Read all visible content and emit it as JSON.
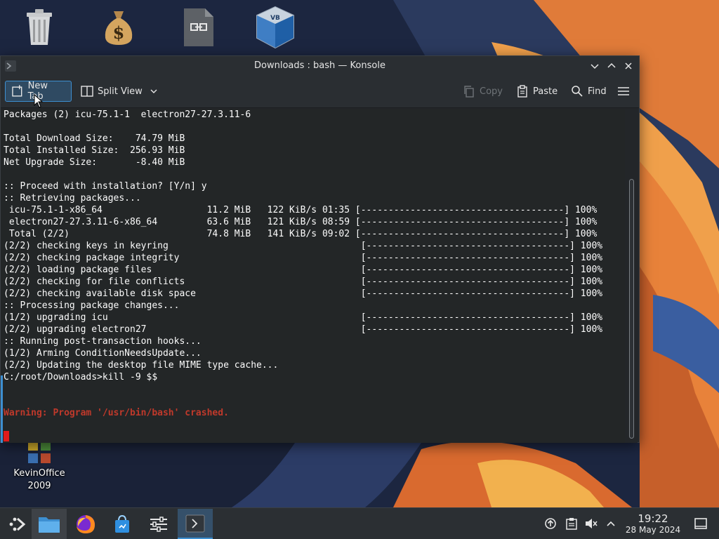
{
  "desktop": {
    "icons": [
      {
        "name": "trash"
      },
      {
        "name": "money-bag"
      },
      {
        "name": "file-link"
      },
      {
        "name": "virtualbox"
      },
      {
        "label_line1": "KevinOffice",
        "label_line2": "2009"
      }
    ]
  },
  "window": {
    "title": "Downloads : bash — Konsole",
    "toolbar": {
      "new_tab": "New Tab",
      "split_view": "Split View",
      "copy": "Copy",
      "paste": "Paste",
      "find": "Find"
    }
  },
  "terminal": {
    "lines": [
      "Packages (2) icu-75.1-1  electron27-27.3.11-6",
      "",
      "Total Download Size:    74.79 MiB",
      "Total Installed Size:  256.93 MiB",
      "Net Upgrade Size:       -8.40 MiB",
      "",
      ":: Proceed with installation? [Y/n] y",
      ":: Retrieving packages...",
      " icu-75.1-1-x86_64                   11.2 MiB   122 KiB/s 01:35 [-------------------------------------] 100%",
      " electron27-27.3.11-6-x86_64         63.6 MiB   121 KiB/s 08:59 [-------------------------------------] 100%",
      " Total (2/2)                         74.8 MiB   141 KiB/s 09:02 [-------------------------------------] 100%",
      "(2/2) checking keys in keyring                                   [-------------------------------------] 100%",
      "(2/2) checking package integrity                                 [-------------------------------------] 100%",
      "(2/2) loading package files                                      [-------------------------------------] 100%",
      "(2/2) checking for file conflicts                                [-------------------------------------] 100%",
      "(2/2) checking available disk space                              [-------------------------------------] 100%",
      ":: Processing package changes...",
      "(1/2) upgrading icu                                              [-------------------------------------] 100%",
      "(2/2) upgrading electron27                                       [-------------------------------------] 100%",
      ":: Running post-transaction hooks...",
      "(1/2) Arming ConditionNeedsUpdate...",
      "(2/2) Updating the desktop file MIME type cache...",
      "C:/root/Downloads>kill -9 $$",
      "",
      "",
      "Warning: Program '/usr/bin/bash' crashed."
    ]
  },
  "taskbar": {
    "clock": {
      "time": "19:22",
      "date": "28 May 2024"
    }
  },
  "colors": {
    "accent": "#3d8fd1",
    "warning": "#c0392b",
    "terminal_bg": "#232627"
  }
}
